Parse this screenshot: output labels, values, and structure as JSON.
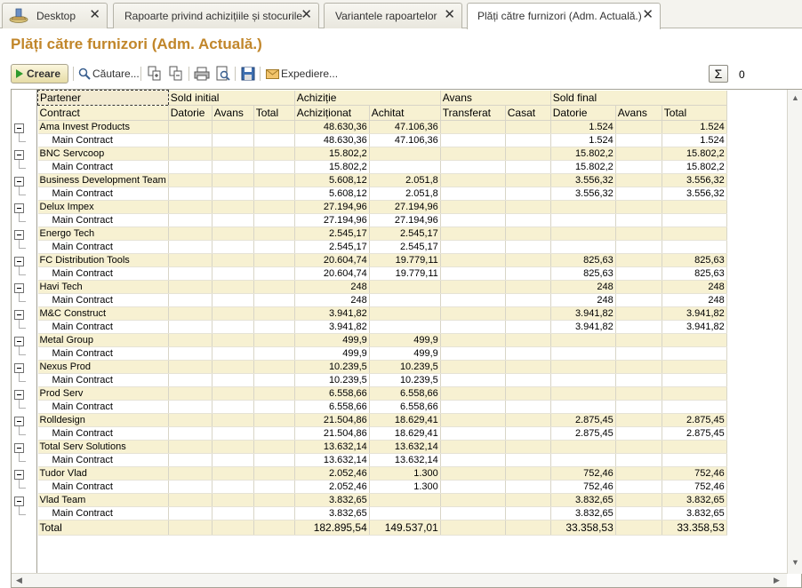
{
  "tabs": [
    {
      "label": "Desktop"
    },
    {
      "label": "Rapoarte privind achizițiile și stocurile"
    },
    {
      "label": "Variantele rapoartelor"
    },
    {
      "label": "Plăți către furnizori (Adm. Actuală.)"
    }
  ],
  "page_title": "Plăți către furnizori (Adm. Actuală.)",
  "toolbar": {
    "create_label": "Creare",
    "search_label": "Căutare...",
    "send_label": "Expediere...",
    "sum_symbol": "Σ",
    "sum_value": "0"
  },
  "table": {
    "header_row1": {
      "partner": "Partener",
      "sold_initial": "Sold initial",
      "achizitie": "Achiziție",
      "avans": "Avans",
      "sold_final": "Sold final"
    },
    "header_row2": {
      "contract": "Contract",
      "datorie": "Datorie",
      "avans": "Avans",
      "total": "Total",
      "achizitionat": "Achiziționat",
      "achitat": "Achitat",
      "transferat": "Transferat",
      "casat": "Casat",
      "datorie_final": "Datorie",
      "avans_final": "Avans",
      "total_final": "Total"
    },
    "rows": [
      {
        "kind": "group",
        "name": "Ama Invest Products",
        "achizitionat": "48.630,36",
        "achitat": "47.106,36",
        "datorie_final": "1.524",
        "total_final": "1.524"
      },
      {
        "kind": "detail",
        "name": "Main Contract",
        "achizitionat": "48.630,36",
        "achitat": "47.106,36",
        "datorie_final": "1.524",
        "total_final": "1.524"
      },
      {
        "kind": "group",
        "name": "BNC Servcoop",
        "achizitionat": "15.802,2",
        "achitat": "",
        "datorie_final": "15.802,2",
        "total_final": "15.802,2"
      },
      {
        "kind": "detail",
        "name": "Main Contract",
        "achizitionat": "15.802,2",
        "achitat": "",
        "datorie_final": "15.802,2",
        "total_final": "15.802,2"
      },
      {
        "kind": "group",
        "name": "Business Development Team",
        "achizitionat": "5.608,12",
        "achitat": "2.051,8",
        "datorie_final": "3.556,32",
        "total_final": "3.556,32"
      },
      {
        "kind": "detail",
        "name": "Main Contract",
        "achizitionat": "5.608,12",
        "achitat": "2.051,8",
        "datorie_final": "3.556,32",
        "total_final": "3.556,32"
      },
      {
        "kind": "group",
        "name": "Delux Impex",
        "achizitionat": "27.194,96",
        "achitat": "27.194,96",
        "datorie_final": "",
        "total_final": ""
      },
      {
        "kind": "detail",
        "name": "Main Contract",
        "achizitionat": "27.194,96",
        "achitat": "27.194,96",
        "datorie_final": "",
        "total_final": ""
      },
      {
        "kind": "group",
        "name": "Energo Tech",
        "achizitionat": "2.545,17",
        "achitat": "2.545,17",
        "datorie_final": "",
        "total_final": ""
      },
      {
        "kind": "detail",
        "name": "Main Contract",
        "achizitionat": "2.545,17",
        "achitat": "2.545,17",
        "datorie_final": "",
        "total_final": ""
      },
      {
        "kind": "group",
        "name": "FC Distribution Tools",
        "achizitionat": "20.604,74",
        "achitat": "19.779,11",
        "datorie_final": "825,63",
        "total_final": "825,63"
      },
      {
        "kind": "detail",
        "name": "Main Contract",
        "achizitionat": "20.604,74",
        "achitat": "19.779,11",
        "datorie_final": "825,63",
        "total_final": "825,63"
      },
      {
        "kind": "group",
        "name": "Havi Tech",
        "achizitionat": "248",
        "achitat": "",
        "datorie_final": "248",
        "total_final": "248"
      },
      {
        "kind": "detail",
        "name": "Main Contract",
        "achizitionat": "248",
        "achitat": "",
        "datorie_final": "248",
        "total_final": "248"
      },
      {
        "kind": "group",
        "name": "M&C Construct",
        "achizitionat": "3.941,82",
        "achitat": "",
        "datorie_final": "3.941,82",
        "total_final": "3.941,82"
      },
      {
        "kind": "detail",
        "name": "Main Contract",
        "achizitionat": "3.941,82",
        "achitat": "",
        "datorie_final": "3.941,82",
        "total_final": "3.941,82"
      },
      {
        "kind": "group",
        "name": "Metal Group",
        "achizitionat": "499,9",
        "achitat": "499,9",
        "datorie_final": "",
        "total_final": ""
      },
      {
        "kind": "detail",
        "name": "Main Contract",
        "achizitionat": "499,9",
        "achitat": "499,9",
        "datorie_final": "",
        "total_final": ""
      },
      {
        "kind": "group",
        "name": "Nexus Prod",
        "achizitionat": "10.239,5",
        "achitat": "10.239,5",
        "datorie_final": "",
        "total_final": ""
      },
      {
        "kind": "detail",
        "name": "Main Contract",
        "achizitionat": "10.239,5",
        "achitat": "10.239,5",
        "datorie_final": "",
        "total_final": ""
      },
      {
        "kind": "group",
        "name": "Prod Serv",
        "achizitionat": "6.558,66",
        "achitat": "6.558,66",
        "datorie_final": "",
        "total_final": ""
      },
      {
        "kind": "detail",
        "name": "Main Contract",
        "achizitionat": "6.558,66",
        "achitat": "6.558,66",
        "datorie_final": "",
        "total_final": ""
      },
      {
        "kind": "group",
        "name": "Rolldesign",
        "achizitionat": "21.504,86",
        "achitat": "18.629,41",
        "datorie_final": "2.875,45",
        "total_final": "2.875,45"
      },
      {
        "kind": "detail",
        "name": "Main Contract",
        "achizitionat": "21.504,86",
        "achitat": "18.629,41",
        "datorie_final": "2.875,45",
        "total_final": "2.875,45"
      },
      {
        "kind": "group",
        "name": "Total Serv Solutions",
        "achizitionat": "13.632,14",
        "achitat": "13.632,14",
        "datorie_final": "",
        "total_final": ""
      },
      {
        "kind": "detail",
        "name": "Main Contract",
        "achizitionat": "13.632,14",
        "achitat": "13.632,14",
        "datorie_final": "",
        "total_final": ""
      },
      {
        "kind": "group",
        "name": "Tudor Vlad",
        "achizitionat": "2.052,46",
        "achitat": "1.300",
        "datorie_final": "752,46",
        "total_final": "752,46"
      },
      {
        "kind": "detail",
        "name": "Main Contract",
        "achizitionat": "2.052,46",
        "achitat": "1.300",
        "datorie_final": "752,46",
        "total_final": "752,46"
      },
      {
        "kind": "group",
        "name": "Vlad Team",
        "achizitionat": "3.832,65",
        "achitat": "",
        "datorie_final": "3.832,65",
        "total_final": "3.832,65"
      },
      {
        "kind": "detail",
        "name": "Main Contract",
        "achizitionat": "3.832,65",
        "achitat": "",
        "datorie_final": "3.832,65",
        "total_final": "3.832,65"
      }
    ],
    "total_row": {
      "label": "Total",
      "achizitionat": "182.895,54",
      "achitat": "149.537,01",
      "datorie_final": "33.358,53",
      "total_final": "33.358,53"
    }
  }
}
